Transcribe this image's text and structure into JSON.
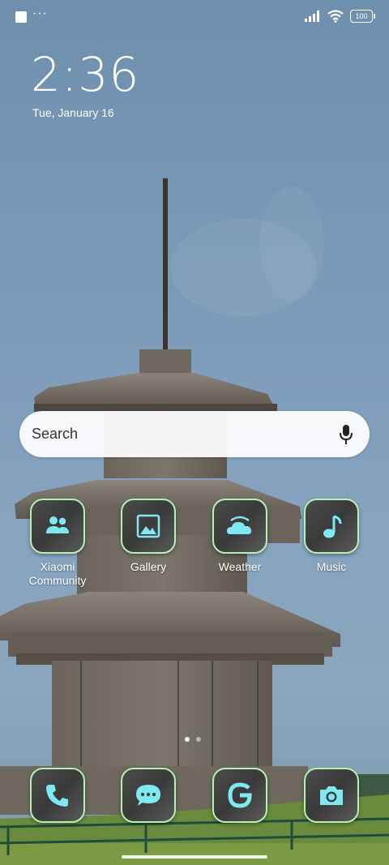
{
  "status_bar": {
    "notification_dots": "···",
    "battery_level": "100"
  },
  "clock": {
    "time": "2:36",
    "date": "Tue, January 16"
  },
  "search": {
    "placeholder": "Search"
  },
  "apps": [
    {
      "label": "Xiaomi\nCommunity",
      "icon": "community-icon"
    },
    {
      "label": "Gallery",
      "icon": "gallery-icon"
    },
    {
      "label": "Weather",
      "icon": "weather-icon"
    },
    {
      "label": "Music",
      "icon": "music-icon"
    }
  ],
  "dock": [
    {
      "icon": "phone-icon"
    },
    {
      "icon": "messages-icon"
    },
    {
      "icon": "google-icon"
    },
    {
      "icon": "camera-icon"
    }
  ],
  "page_indicator": {
    "pages": 2,
    "current": 1
  },
  "colors": {
    "icon_border": "#b6f3b2",
    "icon_glyph": "#7fe9f2",
    "tile_background": "#444444"
  }
}
